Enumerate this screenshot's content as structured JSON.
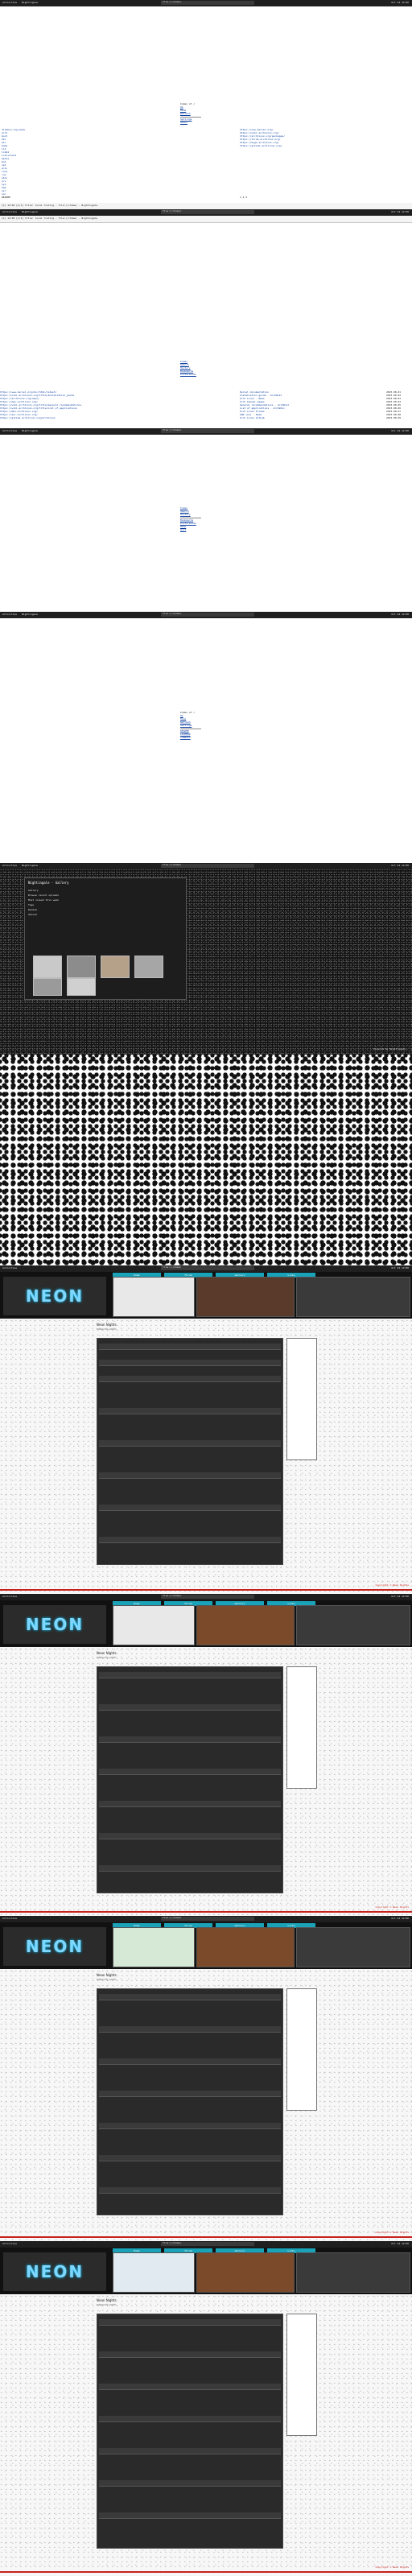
{
  "colors": {
    "topbar": "#1f1f1f",
    "link": "#0a3ea0",
    "accent_red": "#c7211d",
    "accent_cyan": "#1aa3b8"
  },
  "browser": {
    "menu_left": "Activities",
    "app_name": "Nightingale",
    "address": "file:///home/",
    "clock": "Oct 24 12:00",
    "status_right": "▾ ⏻"
  },
  "page1": {
    "header": "Index of /",
    "menu": [
      "Up",
      "Home",
      "Refresh",
      "Settings",
      "About"
    ],
    "left_rows": [
      "disable-log-mode",
      "arch",
      "boot",
      "dev",
      "etc",
      "home",
      "lib",
      "lib64",
      "lost+found",
      "media",
      "mnt",
      "opt",
      "proc",
      "root",
      "run",
      "sbin",
      "srv",
      "sys",
      "tmp",
      "usr",
      "var"
    ],
    "right_rows": [
      "https://www.kernel.org/",
      "https://wiki.archlinux.org/",
      "https://archlinux.org/packages/",
      "https://forum.archlinux.org/",
      "https://bugs.archlinux.org/",
      "https://gitlab.archlinux.org/"
    ],
    "footer_left": "README",
    "footer_right": "1 2 3"
  },
  "infobar_text": "[1] 12:00 [1/1] title: local listing - file:///home/ - Nightingale",
  "page2": {
    "menu": [
      "Index",
      "Search",
      "History",
      "Bookmarks",
      "Preferences"
    ],
    "rows": [
      {
        "url": "https://www.kernel.org/doc/html/latest/",
        "title": "Kernel documentation",
        "date": "2023-08-01"
      },
      {
        "url": "https://wiki.archlinux.org/title/Installation_guide",
        "title": "Installation guide - ArchWiki",
        "date": "2023-08-02"
      },
      {
        "url": "https://archlinux.org/news/",
        "title": "Arch Linux - News",
        "date": "2023-08-03"
      },
      {
        "url": "https://man.archlinux.org/",
        "title": "Arch manual pages",
        "date": "2023-08-04"
      },
      {
        "url": "https://wiki.archlinux.org/title/General_recommendations",
        "title": "General recommendations - ArchWiki",
        "date": "2023-08-05"
      },
      {
        "url": "https://wiki.archlinux.org/title/List_of_applications",
        "title": "List of applications - ArchWiki",
        "date": "2023-08-06"
      },
      {
        "url": "https://bbs.archlinux.org/",
        "title": "Arch Linux Forums",
        "date": "2023-08-07"
      },
      {
        "url": "https://aur.archlinux.org/",
        "title": "AUR (en) - Home",
        "date": "2023-08-08"
      },
      {
        "url": "https://gitlab.archlinux.org/archlinux",
        "title": "Arch Linux GitLab",
        "date": "2023-08-09"
      }
    ]
  },
  "page3": {
    "menu": [
      "Index",
      "Search",
      "History",
      "Bookmarks",
      "Preferences",
      "Help",
      "Quit"
    ]
  },
  "page4": {
    "header": "Index of /",
    "menu": [
      "Up",
      "Home",
      "Refresh",
      "Settings"
    ],
    "sub": [
      "README",
      "LICENSE",
      "CHANGES"
    ]
  },
  "dark_page": {
    "title": "Nightingale - Gallery",
    "lines": [
      "Gallery",
      "Browse recent uploads",
      "Most viewed this week",
      "Tags",
      "Random",
      "Upload"
    ],
    "footer": "Powered by Nightingale"
  },
  "neon_pages": [
    {
      "tabs": [
        "Home",
        "Forum",
        "Gallery",
        "Links"
      ],
      "post_title": "Neon Nights",
      "post_sub": "Posted by admin",
      "logo": "NEON",
      "footer": "Copyright © Neon Nights"
    },
    {
      "tabs": [
        "Home",
        "Forum",
        "Gallery",
        "Links"
      ],
      "post_title": "Neon Nights",
      "post_sub": "Posted by admin",
      "logo": "NEON",
      "footer": "Copyright © Neon Nights"
    },
    {
      "tabs": [
        "Home",
        "Forum",
        "Gallery",
        "Links"
      ],
      "post_title": "Neon Nights",
      "post_sub": "Posted by admin",
      "logo": "NEON",
      "footer": "Copyright © Neon Nights"
    },
    {
      "tabs": [
        "Home",
        "Forum",
        "Gallery",
        "Links"
      ],
      "post_title": "Neon Nights",
      "post_sub": "Posted by admin",
      "logo": "NEON",
      "footer": "Copyright © Neon Nights"
    }
  ]
}
